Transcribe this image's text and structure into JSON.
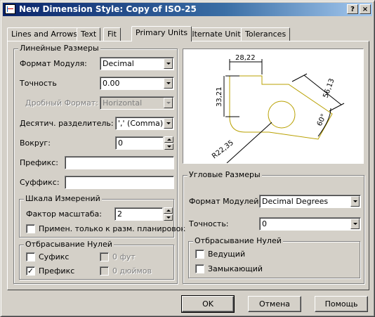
{
  "window": {
    "title": "New Dimension Style: Copy of ISO-25",
    "help_btn": "?",
    "close_btn": "×"
  },
  "tabs": [
    "Lines and Arrows",
    "Text",
    "Fit",
    "Primary Units",
    "Alternate Units",
    "Tolerances"
  ],
  "linear": {
    "group_title": "Линейные Размеры",
    "unit_format": {
      "label": "Формат Модуля:",
      "value": "Decimal"
    },
    "precision": {
      "label": "Точность",
      "value": "0.00"
    },
    "fraction_format": {
      "label": "Дробный Формат:",
      "value": "Horizontal"
    },
    "decimal_separator": {
      "label": "Десятич. разделитель:",
      "value": "',' (Comma)"
    },
    "round_off": {
      "label": "Вокруг:",
      "value": "0"
    },
    "prefix": {
      "label": "Префикс:",
      "value": ""
    },
    "suffix": {
      "label": "Суффикс:",
      "value": ""
    }
  },
  "measurement_scale": {
    "group_title": "Шкала Измерений",
    "scale_factor": {
      "label": "Фактор масштаба:",
      "value": "2"
    },
    "apply_layout": {
      "label": "Примен. только к разм. планировок",
      "checked": false
    }
  },
  "zero_suppression": {
    "group_title": "Отбрасывание Нулей",
    "suffix": {
      "label": "Суфикс",
      "checked": false
    },
    "prefix": {
      "label": "Префикс",
      "checked": true
    },
    "feet": {
      "label": "0 фут",
      "checked": false
    },
    "inches": {
      "label": "0 дюймов",
      "checked": false
    }
  },
  "preview": {
    "dims": [
      "28,22",
      "33,21",
      "56,13",
      "60°",
      "R22,35"
    ],
    "line_color": "#b8a000"
  },
  "angular": {
    "group_title": "Угловые Размеры",
    "units_format": {
      "label": "Формат Модулей:",
      "value": "Decimal Degrees"
    },
    "precision": {
      "label": "Точность:",
      "value": "0"
    }
  },
  "angular_zero_suppression": {
    "group_title": "Отбрасывание Нулей",
    "leading": {
      "label": "Ведущий",
      "checked": false
    },
    "trailing": {
      "label": "Замыкающий",
      "checked": false
    }
  },
  "buttons": {
    "ok": "OK",
    "cancel": "Отмена",
    "help": "Помощь"
  }
}
